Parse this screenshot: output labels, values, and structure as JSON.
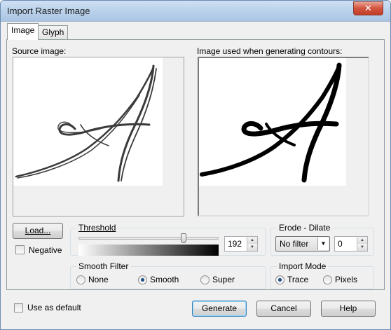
{
  "window": {
    "title": "Import Raster Image",
    "close_glyph": "✕"
  },
  "tabs": [
    {
      "label": "Image",
      "active": true
    },
    {
      "label": "Glyph",
      "active": false
    }
  ],
  "source_label": "Source image:",
  "contour_label": "Image used when generating contours:",
  "load_button": "Load...",
  "negative_label": "Negative",
  "negative_checked": false,
  "threshold": {
    "title": "Threshold",
    "value": "192",
    "level": 0.75
  },
  "erode_dilate": {
    "title": "Erode - Dilate",
    "filter": "No filter",
    "value": "0"
  },
  "smooth_filter": {
    "title": "Smooth Filter",
    "options": [
      "None",
      "Smooth",
      "Super"
    ],
    "selected": "Smooth"
  },
  "import_mode": {
    "title": "Import Mode",
    "options": [
      "Trace",
      "Pixels"
    ],
    "selected": "Trace"
  },
  "use_default_label": "Use as default",
  "buttons": {
    "generate": "Generate",
    "cancel": "Cancel",
    "help": "Help"
  },
  "colors": {
    "accent": "#1a4e86",
    "title_bar": "#b9d1ea",
    "close": "#c03e27"
  }
}
